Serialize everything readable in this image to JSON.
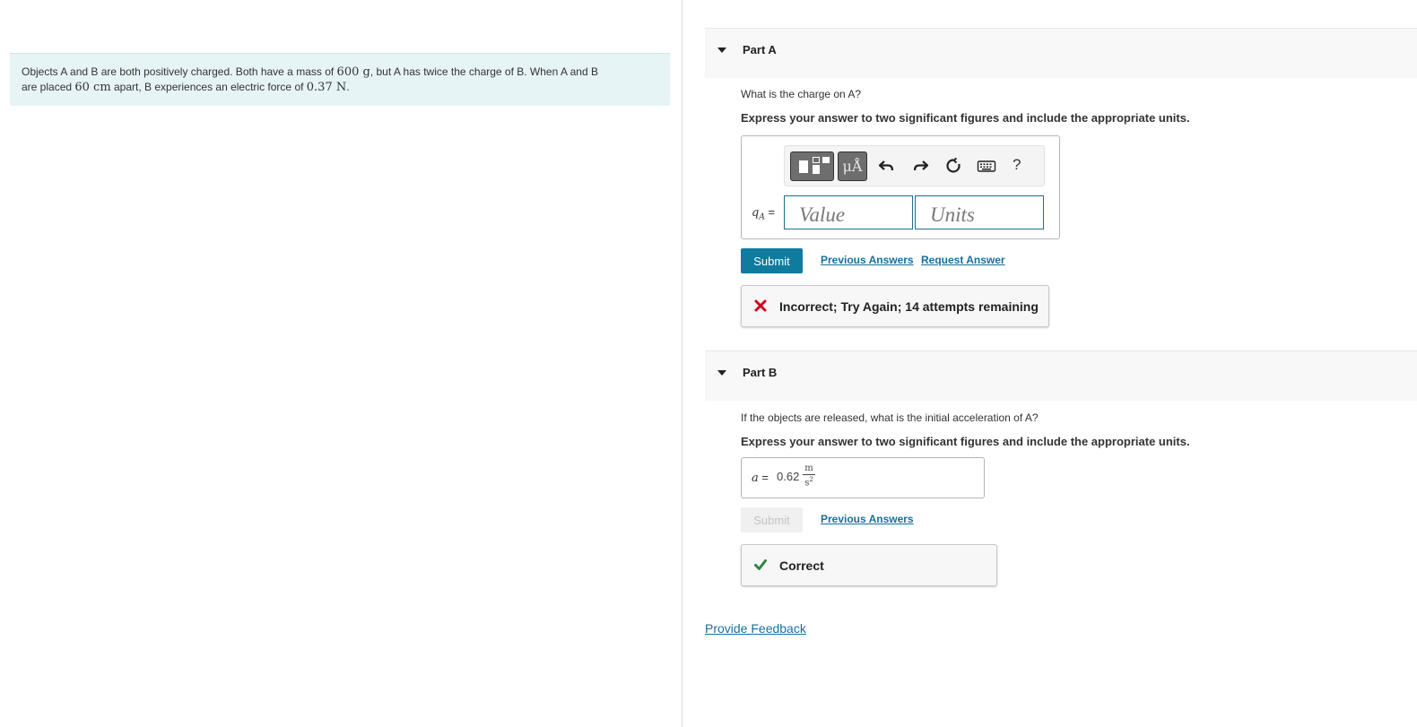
{
  "problem": {
    "text_1": "Objects A and B are both positively charged. Both have a mass of ",
    "mass": "600 g",
    "text_2": ", but A has twice the charge of B. When A and B",
    "text_3": "are placed ",
    "distance": "60 cm",
    "text_4": " apart, B experiences an electric force of ",
    "force": "0.37 N",
    "text_5": "."
  },
  "part_a": {
    "title": "Part A",
    "question": "What is the charge on A?",
    "instruction": "Express your answer to two significant figures and include the appropriate units.",
    "toolbar": {
      "units_label": "μÅ",
      "help_label": "?"
    },
    "variable": "q",
    "variable_sub": "A",
    "equals": "=",
    "value_placeholder": "Value",
    "units_placeholder": "Units",
    "submit_label": "Submit",
    "previous_answers_label": "Previous Answers",
    "request_answer_label": "Request Answer",
    "feedback": "Incorrect; Try Again; 14 attempts remaining",
    "feedback_color": "#d0021b"
  },
  "part_b": {
    "title": "Part B",
    "question": "If the objects are released, what is the initial acceleration of A?",
    "instruction": "Express your answer to two significant figures and include the appropriate units.",
    "variable": "a",
    "equals": "=",
    "answer_value": "0.62",
    "unit_num": "m",
    "unit_den": "s",
    "unit_den_exp": "2",
    "submit_label": "Submit",
    "previous_answers_label": "Previous Answers",
    "feedback": "Correct",
    "feedback_color": "#2e8540"
  },
  "footer": {
    "provide_feedback_label": "Provide Feedback"
  },
  "colors": {
    "accent": "#0f7b9e",
    "link": "#1a6e9a",
    "problem_bg": "#e6f4f5"
  }
}
